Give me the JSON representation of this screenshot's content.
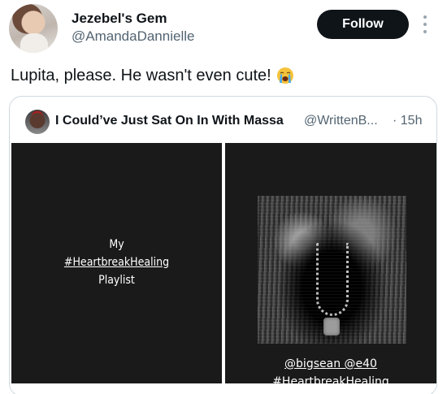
{
  "author": {
    "name": "Jezebel's Gem",
    "handle": "@AmandaDannielle",
    "follow_label": "Follow"
  },
  "tweet": {
    "text": "Lupita, please. He wasn't even cute!",
    "emoji": "😭"
  },
  "quoted": {
    "name": "I Could’ve Just Sat On In With Massa",
    "handle": "@WrittenB...",
    "time": "· 15h",
    "left_story": {
      "line1": "My",
      "line2": "#HeartbreakHealing",
      "line3": "Playlist"
    },
    "right_story": {
      "mentions": "@bigsean @e40",
      "hashtag": "#HeartbreakHealing"
    }
  },
  "icons": {
    "more": "more-vertical-icon",
    "emoji": "crying-face-icon"
  }
}
